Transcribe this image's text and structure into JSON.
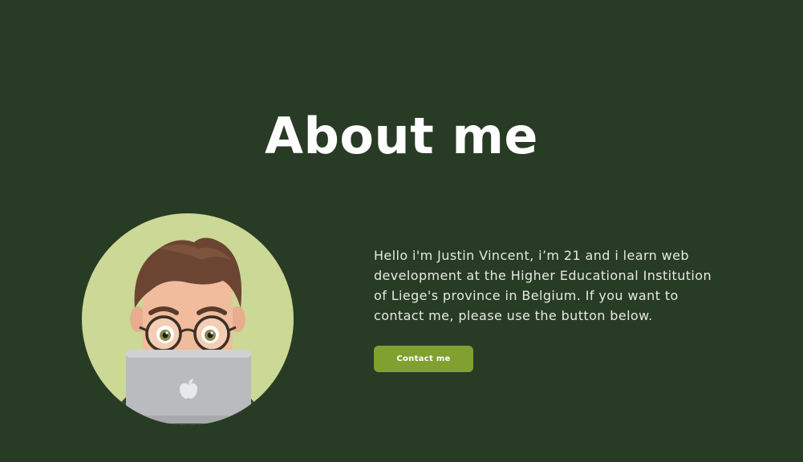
{
  "about": {
    "title": "About me",
    "bio": "Hello i'm Justin Vincent, i’m 21 and i learn web development at the Higher Educational Institution of Liege's province in Belgium. If you want to contact me, please use the button below.",
    "contact_label": "Contact me"
  },
  "colors": {
    "background": "#283b25",
    "avatar_circle": "#ccd896",
    "button": "#80a12f",
    "text": "#ffffff"
  },
  "icons": {
    "avatar": "memoji-avatar-with-laptop",
    "laptop_logo": "apple-logo-icon"
  }
}
